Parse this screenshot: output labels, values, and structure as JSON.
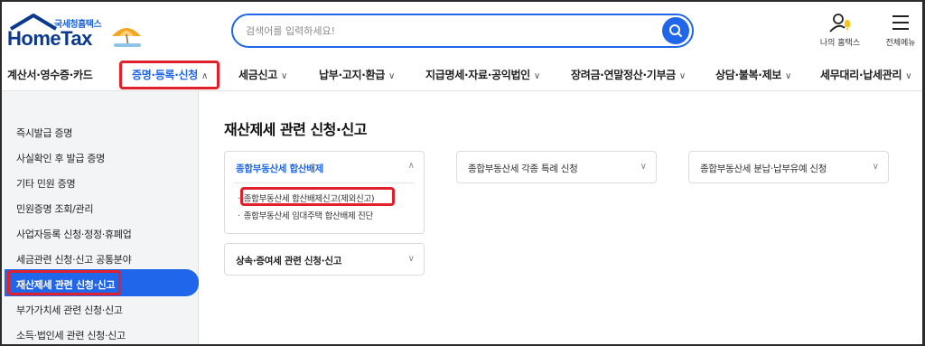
{
  "header": {
    "logo_sub": "국세청홈택스",
    "logo_main": "HomeTax",
    "search_placeholder": "검색어를 입력하세요!",
    "my_hometax_label": "나의 홈택스",
    "all_menu_label": "전체메뉴"
  },
  "nav": {
    "items": [
      {
        "label": "계산서·영수증·카드"
      },
      {
        "label": "증명·등록·신청"
      },
      {
        "label": "세금신고"
      },
      {
        "label": "납부·고지·환급"
      },
      {
        "label": "지급명세·자료·공익법인"
      },
      {
        "label": "장려금·연말정산·기부금"
      },
      {
        "label": "상담·불복·제보"
      },
      {
        "label": "세무대리·납세관리"
      }
    ],
    "active_index": 1
  },
  "sidebar": {
    "items": [
      {
        "label": "즉시발급 증명"
      },
      {
        "label": "사실확인 후 발급 증명"
      },
      {
        "label": "기타 민원 증명"
      },
      {
        "label": "민원증명 조회/관리"
      },
      {
        "label": "사업자등록 신청·정정·휴폐업"
      },
      {
        "label": "세금관련 신청·신고 공통분야"
      },
      {
        "label": "재산제세 관련 신청·신고"
      },
      {
        "label": "부가가치세 관련 신청·신고"
      },
      {
        "label": "소득·법인세 관련 신청·신고"
      }
    ],
    "active_index": 6
  },
  "main": {
    "title": "재산제세 관련 신청·신고",
    "cards": [
      {
        "title": "종합부동산세 합산배제",
        "expanded": true,
        "items": [
          {
            "label": "종합부동산세 합산배제신고(제외신고)"
          },
          {
            "label": "종합부동산세 임대주택 합산배제 진단"
          }
        ]
      },
      {
        "title": "종합부동산세 각종 특례 신청",
        "expanded": false
      },
      {
        "title": "종합부동산세 분납·납부유예 신청",
        "expanded": false
      },
      {
        "title": "상속·증여세 관련 신청·신고",
        "expanded": false
      }
    ]
  },
  "colors": {
    "brand_blue": "#1f66ea",
    "highlight_red": "#e0202a",
    "sidebar_bg": "#f3f4f6"
  },
  "icons": {
    "search": "search-icon",
    "my_hometax": "user-bell-icon",
    "all_menu": "hamburger-icon",
    "chevron": "chevron-icon"
  }
}
